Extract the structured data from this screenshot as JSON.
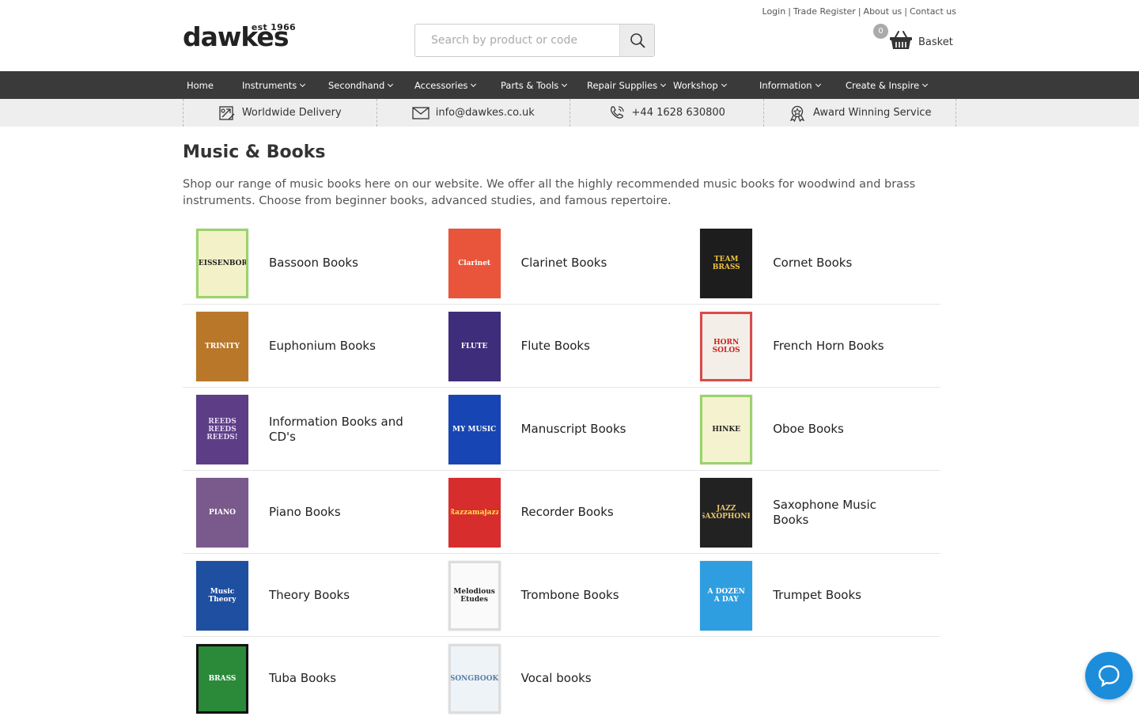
{
  "header": {
    "logo_text": "dawkes",
    "logo_est": "est 1966",
    "search_placeholder": "Search by product or code",
    "top_links": [
      "Login",
      "Trade Register",
      "About us",
      "Contact us"
    ],
    "basket_count": "0",
    "basket_label": "Basket"
  },
  "nav": {
    "items": [
      {
        "label": "Home",
        "has_dropdown": false
      },
      {
        "label": "Instruments",
        "has_dropdown": true
      },
      {
        "label": "Secondhand",
        "has_dropdown": true
      },
      {
        "label": "Accessories",
        "has_dropdown": true
      },
      {
        "label": "Parts & Tools",
        "has_dropdown": true
      },
      {
        "label": "Repair Supplies",
        "has_dropdown": true
      },
      {
        "label": "Workshop",
        "has_dropdown": true
      },
      {
        "label": "Information",
        "has_dropdown": true
      },
      {
        "label": "Create & Inspire",
        "has_dropdown": true
      }
    ]
  },
  "usp": [
    {
      "label": "Worldwide Delivery",
      "icon": "delivery-icon"
    },
    {
      "label": "info@dawkes.co.uk",
      "icon": "email-icon"
    },
    {
      "label": "+44 1628 630800",
      "icon": "phone-icon"
    },
    {
      "label": "Award Winning Service",
      "icon": "award-icon"
    }
  ],
  "page": {
    "title": "Music & Books",
    "intro": "Shop our range of music books here on our website. We offer all the highly recommended music books for woodwind and brass instruments. Choose from beginner books, advanced studies, and famous repertoire."
  },
  "categories": [
    {
      "label": "Bassoon Books",
      "cover_text": "WEISSENBORN",
      "cover_bg": "#f3f1c8",
      "cover_fg": "#222",
      "cover_border": "#9bd36b"
    },
    {
      "label": "Clarinet Books",
      "cover_text": "Clarinet",
      "cover_bg": "#e9553a",
      "cover_fg": "#fff",
      "cover_border": "#e9553a"
    },
    {
      "label": "Cornet Books",
      "cover_text": "TEAM BRASS",
      "cover_bg": "#1d1d1d",
      "cover_fg": "#f0c540",
      "cover_border": "#1d1d1d"
    },
    {
      "label": "Euphonium Books",
      "cover_text": "TRINITY",
      "cover_bg": "#b9772a",
      "cover_fg": "#fff",
      "cover_border": "#b9772a"
    },
    {
      "label": "Flute Books",
      "cover_text": "FLUTE",
      "cover_bg": "#3e2d7a",
      "cover_fg": "#fff",
      "cover_border": "#3e2d7a"
    },
    {
      "label": "French Horn Books",
      "cover_text": "HORN SOLOS",
      "cover_bg": "#f3efe8",
      "cover_fg": "#c22",
      "cover_border": "#d94b4b"
    },
    {
      "label": "Information Books and CD's",
      "cover_text": "REEDS REEDS REEDS!",
      "cover_bg": "#5c3d86",
      "cover_fg": "#e8d9f5",
      "cover_border": "#5c3d86"
    },
    {
      "label": "Manuscript Books",
      "cover_text": "MY MUSIC",
      "cover_bg": "#1745b3",
      "cover_fg": "#fff",
      "cover_border": "#1745b3"
    },
    {
      "label": "Oboe Books",
      "cover_text": "HINKE",
      "cover_bg": "#f4f2cf",
      "cover_fg": "#222",
      "cover_border": "#9bd36b"
    },
    {
      "label": "Piano Books",
      "cover_text": "PIANO",
      "cover_bg": "#7a5a8c",
      "cover_fg": "#fff",
      "cover_border": "#7a5a8c"
    },
    {
      "label": "Recorder Books",
      "cover_text": "Razzamajazz",
      "cover_bg": "#d72d2d",
      "cover_fg": "#ffe14a",
      "cover_border": "#d72d2d"
    },
    {
      "label": "Saxophone Music Books",
      "cover_text": "JAZZ SAXOPHONE",
      "cover_bg": "#222",
      "cover_fg": "#e9c56b",
      "cover_border": "#222"
    },
    {
      "label": "Theory Books",
      "cover_text": "Music Theory",
      "cover_bg": "#1f4fa0",
      "cover_fg": "#fff",
      "cover_border": "#1f4fa0"
    },
    {
      "label": "Trombone Books",
      "cover_text": "Melodious Etudes",
      "cover_bg": "#fafafa",
      "cover_fg": "#222",
      "cover_border": "#ddd"
    },
    {
      "label": "Trumpet Books",
      "cover_text": "A DOZEN A DAY",
      "cover_bg": "#2f9ee0",
      "cover_fg": "#fff",
      "cover_border": "#2f9ee0"
    },
    {
      "label": "Tuba Books",
      "cover_text": "BRASS",
      "cover_bg": "#2a8a3a",
      "cover_fg": "#fff",
      "cover_border": "#111"
    },
    {
      "label": "Vocal books",
      "cover_text": "SONGBOOK",
      "cover_bg": "#eef3f7",
      "cover_fg": "#5a7ea6",
      "cover_border": "#ddd"
    }
  ]
}
